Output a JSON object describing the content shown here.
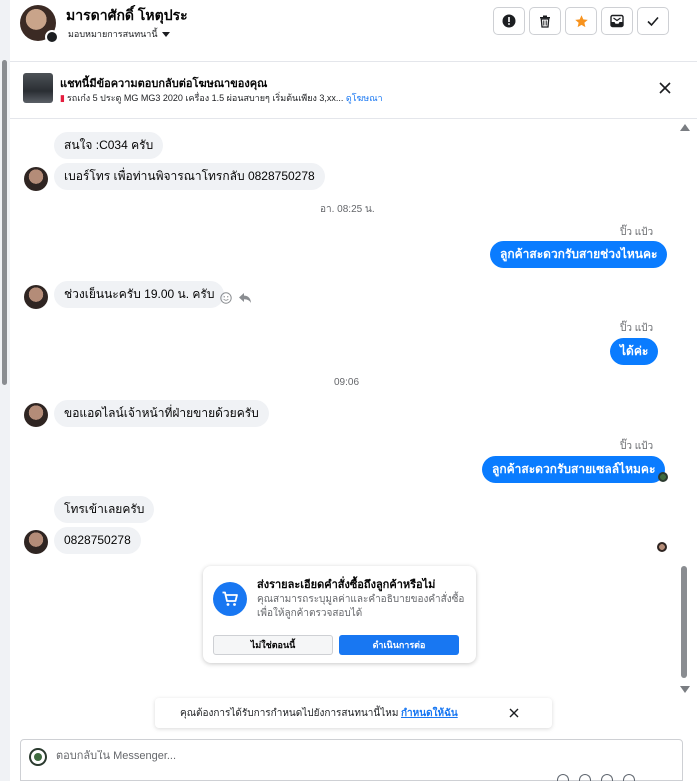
{
  "header": {
    "contact_name": "มารดาศักดิ์ โหตุประ",
    "assign_label": "มอบหมายการสนทนานี้",
    "actions": [
      {
        "icon": "exclamation-icon"
      },
      {
        "icon": "trash-icon"
      },
      {
        "icon": "star-icon"
      },
      {
        "icon": "mail-icon"
      },
      {
        "icon": "check-icon"
      }
    ]
  },
  "ad": {
    "title": "แชทนี้มีข้อความตอบกลับต่อโฆษณาของคุณ",
    "description": "รถเก๋ง 5 ประตู MG MG3 2020 เครื่อง 1.5 ผ่อนสบายๆ เริ่มต้นเพียง 3,xx...",
    "link": "ดูโฆษณา"
  },
  "messages": {
    "m1": "สนใจ :C034 ครับ",
    "m2": "เบอร์โทร เพื่อท่านพิจารณาโทรกลับ 0828750278",
    "ts1": "อา. 08:25 น.",
    "sender1": "ปิ๊ว แป้ว",
    "m3": "ลูกค้าสะดวกรับสายช่วงไหนคะ",
    "m4": "ช่วงเย็นนะครับ 19.00 น. ครับ",
    "sender2": "ปิ๊ว แป้ว",
    "m5": "ได้ค่ะ",
    "ts2": "09:06",
    "m6": "ขอแอดไลน์เจ้าหน้าที่ฝ่ายขายด้วยครับ",
    "sender3": "ปิ๊ว แป้ว",
    "m7": "ลูกค้าสะดวกรับสายเซลล์ไหมคะ",
    "m8": "โทรเข้าเลยครับ",
    "m9": "0828750278"
  },
  "order_card": {
    "title": "ส่งรายละเอียดคำสั่งซื้อถึงลูกค้าหรือไม่",
    "description": "คุณสามารถระบุมูลค่าและคำอธิบายของคำสั่งซื้อ เพื่อให้ลูกค้าตรวจสอบได้",
    "secondary": "ไม่ใช่ตอนนี้",
    "primary": "ดำเนินการต่อ"
  },
  "notice": {
    "text": "คุณต้องการได้รับการกำหนดไปยังการสนทนานี้ไหม",
    "link": "กำหนดให้ฉัน"
  },
  "composer": {
    "placeholder": "ตอบกลับใน Messenger..."
  },
  "colors": {
    "accent": "#0a7cff",
    "star": "#f7931e"
  }
}
